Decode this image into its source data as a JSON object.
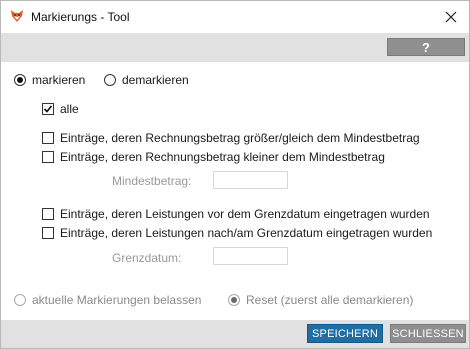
{
  "window": {
    "title": "Markierungs - Tool"
  },
  "toolbar": {
    "help_label": "?"
  },
  "mode": {
    "mark_label": "markieren",
    "mark_selected": true,
    "unmark_label": "demarkieren",
    "unmark_selected": false
  },
  "options": {
    "all_label": "alle",
    "all_checked": true,
    "amount_ge_label": "Einträge, deren Rechnungsbetrag größer/gleich dem Mindestbetrag",
    "amount_ge_checked": false,
    "amount_lt_label": "Einträge, deren Rechnungsbetrag kleiner dem Mindestbetrag",
    "amount_lt_checked": false,
    "min_amount_label": "Mindestbetrag:",
    "min_amount_value": "",
    "before_date_label": "Einträge, deren Leistungen vor dem Grenzdatum eingetragen wurden",
    "before_date_checked": false,
    "after_date_label": "Einträge, deren Leistungen nach/am Grenzdatum eingetragen wurden",
    "after_date_checked": false,
    "date_label": "Grenzdatum:",
    "date_value": ""
  },
  "existing": {
    "keep_label": "aktuelle Markierungen belassen",
    "keep_selected": false,
    "reset_label": "Reset (zuerst alle demarkieren)",
    "reset_selected": true
  },
  "footer": {
    "save_label": "SPEICHERN",
    "close_label": "SCHLIESSEN"
  },
  "colors": {
    "primary_button": "#1f6fa6",
    "secondary_button": "#8f8f8f",
    "bar_background": "#e1e1e1"
  },
  "icons": {
    "app": "fox-app-icon",
    "close": "close-icon",
    "check": "checkmark-icon"
  }
}
